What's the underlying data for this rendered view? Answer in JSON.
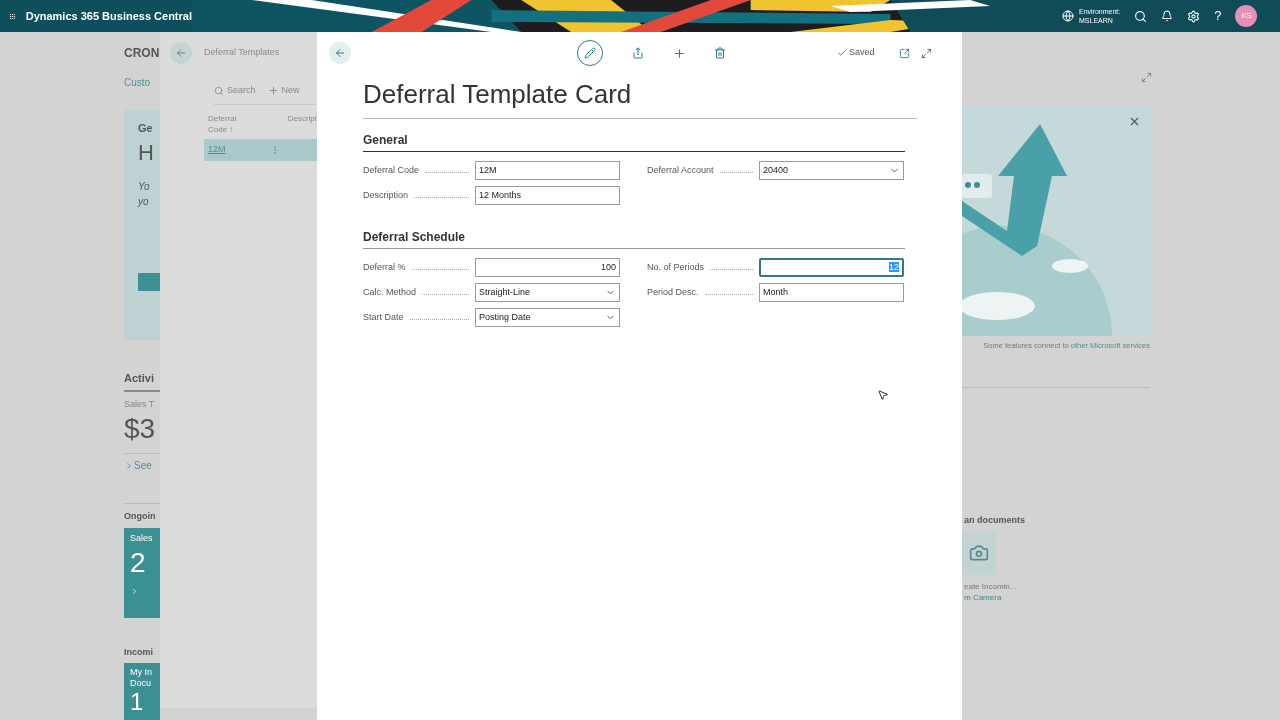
{
  "app_bar": {
    "title": "Dynamics 365 Business Central",
    "environment_label": "Environment:",
    "environment_name": "MSLEARN",
    "help_glyph": "?",
    "avatar": "KS"
  },
  "background_page": {
    "company": "CRON",
    "breadcrumb": "Custo",
    "headline": {
      "title": "Ge",
      "greeting": "H",
      "lines": [
        "Yo",
        "yo"
      ]
    },
    "activities": {
      "heading": "Activi",
      "kpi_label": "Sales T",
      "kpi_value": "$3",
      "link": "See"
    },
    "ongoing": {
      "heading": "Ongoin",
      "tile_label": "Sales",
      "tile_value": "2"
    },
    "incoming": {
      "heading": "Incomi",
      "tile_lines": [
        "My In",
        "Docu"
      ],
      "tile_value": "1"
    },
    "notice": {
      "text": "Some features connect to",
      "link": "other Microsoft services"
    },
    "scan": {
      "heading": "an documents",
      "action_lines": [
        "eate Incomin...",
        "m Camera"
      ]
    }
  },
  "list_page": {
    "title": "Deferral Templates",
    "actions": [
      {
        "kind": "search",
        "label": "Search"
      },
      {
        "kind": "new",
        "label": "New"
      }
    ],
    "columns": [
      {
        "lines": [
          "Deferral",
          "Code ↑"
        ]
      },
      {
        "lines": [
          "Descript"
        ]
      }
    ],
    "rows": [
      {
        "code": "12M",
        "selected": true
      }
    ]
  },
  "card": {
    "title": "Deferral Template Card",
    "status": "Saved",
    "sections": [
      {
        "title": "General",
        "columns": [
          [
            {
              "label": "Deferral Code",
              "value": "12M",
              "kind": "text",
              "focused": false
            },
            {
              "label": "Description",
              "value": "12 Months",
              "kind": "text",
              "focused": false
            }
          ],
          [
            {
              "label": "Deferral Account",
              "value": "20400",
              "kind": "dropdown",
              "focused": false
            }
          ]
        ]
      },
      {
        "title": "Deferral Schedule",
        "columns": [
          [
            {
              "label": "Deferral %",
              "value": "100",
              "kind": "number",
              "focused": false
            },
            {
              "label": "Calc. Method",
              "value": "Straight-Line",
              "kind": "dropdown",
              "focused": false
            },
            {
              "label": "Start Date",
              "value": "Posting Date",
              "kind": "dropdown",
              "focused": false
            }
          ],
          [
            {
              "label": "No. of Periods",
              "value": "12",
              "kind": "number",
              "focused": true
            },
            {
              "label": "Period Desc.",
              "value": "Month",
              "kind": "text",
              "focused": false
            }
          ]
        ]
      }
    ]
  }
}
